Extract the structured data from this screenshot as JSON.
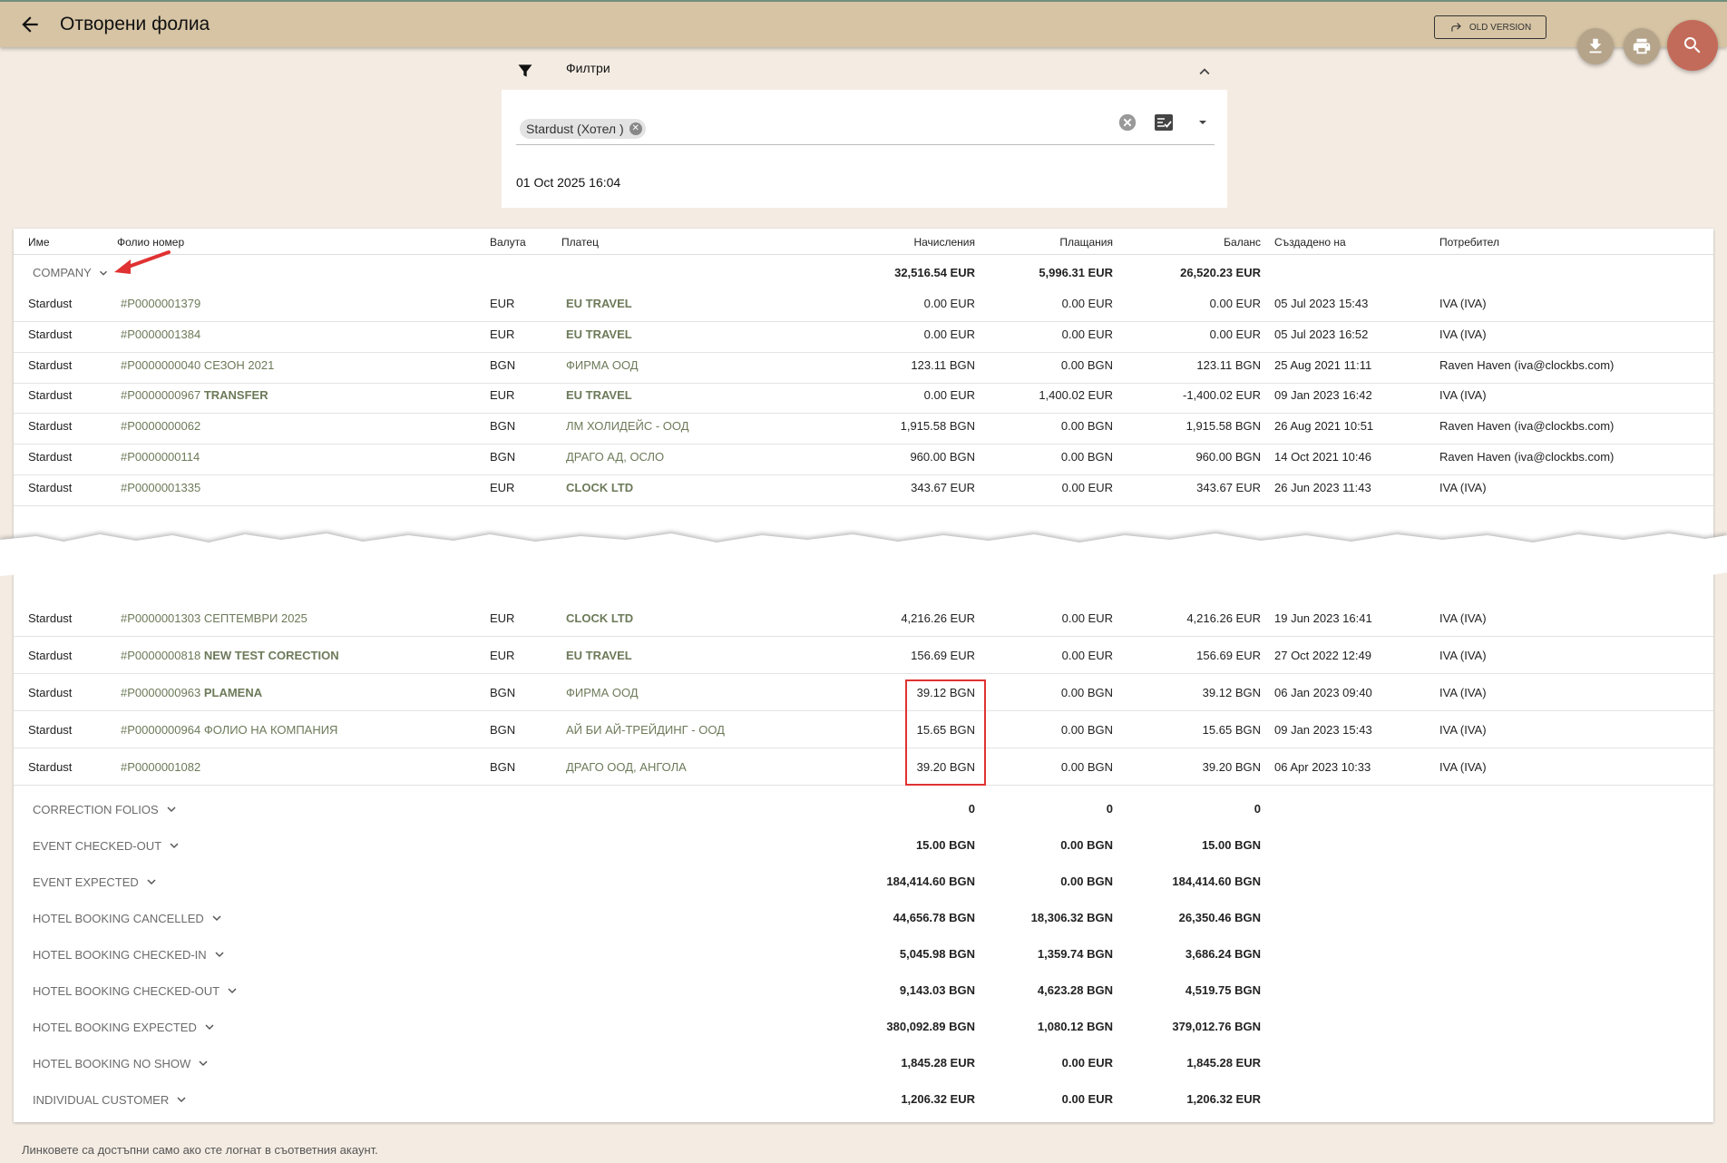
{
  "header": {
    "title": "Отворени фолиа",
    "old_version": "OLD VERSION"
  },
  "filter": {
    "label": "Филтри",
    "chip": "Stardust (Хотел )",
    "date": "01 Oct 2025 16:04"
  },
  "table": {
    "columns": [
      "Име",
      "Фолио номер",
      "Валута",
      "Платец",
      "Начисления",
      "Плащания",
      "Баланс",
      "Създадено на",
      "Потребител"
    ],
    "company_group": {
      "label": "COMPANY",
      "charges": "32,516.54 EUR",
      "payments": "5,996.31 EUR",
      "balance": "26,520.23 EUR"
    },
    "rows_top": [
      {
        "name": "Stardust",
        "folio": "#P0000001379",
        "folio_extra": "",
        "currency": "EUR",
        "payer": "EU TRAVEL",
        "charges": "0.00 EUR",
        "payments": "0.00 EUR",
        "balance": "0.00 EUR",
        "created": "05 Jul 2023 15:43",
        "user": "IVA (IVA)"
      },
      {
        "name": "Stardust",
        "folio": "#P0000001384",
        "folio_extra": "",
        "currency": "EUR",
        "payer": "EU TRAVEL",
        "charges": "0.00 EUR",
        "payments": "0.00 EUR",
        "balance": "0.00 EUR",
        "created": "05 Jul 2023 16:52",
        "user": "IVA (IVA)"
      },
      {
        "name": "Stardust",
        "folio": "#P0000000040",
        "folio_extra": "СЕЗОН 2021",
        "currency": "BGN",
        "payer": "ФИРМА ООД",
        "charges": "123.11 BGN",
        "payments": "0.00 BGN",
        "balance": "123.11 BGN",
        "created": "25 Aug 2021 11:11",
        "user": "Raven Haven (iva@clockbs.com)"
      },
      {
        "name": "Stardust",
        "folio": "#P0000000967",
        "folio_extra": "TRANSFER",
        "currency": "EUR",
        "payer": "EU TRAVEL",
        "charges": "0.00 EUR",
        "payments": "1,400.02 EUR",
        "balance": "-1,400.02 EUR",
        "created": "09 Jan 2023 16:42",
        "user": "IVA (IVA)"
      },
      {
        "name": "Stardust",
        "folio": "#P0000000062",
        "folio_extra": "",
        "currency": "BGN",
        "payer": "ЛМ ХОЛИДЕЙС - ООД",
        "charges": "1,915.58 BGN",
        "payments": "0.00 BGN",
        "balance": "1,915.58 BGN",
        "created": "26 Aug 2021 10:51",
        "user": "Raven Haven (iva@clockbs.com)"
      },
      {
        "name": "Stardust",
        "folio": "#P0000000114",
        "folio_extra": "",
        "currency": "BGN",
        "payer": "ДРАГО АД, ОСЛО",
        "charges": "960.00 BGN",
        "payments": "0.00 BGN",
        "balance": "960.00 BGN",
        "created": "14 Oct 2021 10:46",
        "user": "Raven Haven (iva@clockbs.com)"
      },
      {
        "name": "Stardust",
        "folio": "#P0000001335",
        "folio_extra": "",
        "currency": "EUR",
        "payer": "CLOCK LTD",
        "charges": "343.67 EUR",
        "payments": "0.00 EUR",
        "balance": "343.67 EUR",
        "created": "26 Jun 2023 11:43",
        "user": "IVA (IVA)"
      }
    ],
    "rows_bottom": [
      {
        "name": "Stardust",
        "folio": "#P0000001303",
        "folio_extra": "СЕПТЕМВРИ 2025",
        "currency": "EUR",
        "payer": "CLOCK LTD",
        "charges": "4,216.26 EUR",
        "payments": "0.00 EUR",
        "balance": "4,216.26 EUR",
        "created": "19 Jun 2023 16:41",
        "user": "IVA (IVA)"
      },
      {
        "name": "Stardust",
        "folio": "#P0000000818",
        "folio_extra": "NEW TEST CORECTION",
        "currency": "EUR",
        "payer": "EU TRAVEL",
        "charges": "156.69 EUR",
        "payments": "0.00 EUR",
        "balance": "156.69 EUR",
        "created": "27 Oct 2022 12:49",
        "user": "IVA (IVA)"
      },
      {
        "name": "Stardust",
        "folio": "#P0000000963",
        "folio_extra": "PLAMENA",
        "currency": "BGN",
        "payer": "ФИРМА ООД",
        "charges": "39.12 BGN",
        "payments": "0.00 BGN",
        "balance": "39.12 BGN",
        "created": "06 Jan 2023 09:40",
        "user": "IVA (IVA)"
      },
      {
        "name": "Stardust",
        "folio": "#P0000000964",
        "folio_extra": "ФОЛИО НА КОМПАНИЯ",
        "currency": "BGN",
        "payer": "АЙ БИ АЙ-ТРЕЙДИНГ - ООД",
        "charges": "15.65 BGN",
        "payments": "0.00 BGN",
        "balance": "15.65 BGN",
        "created": "09 Jan 2023 15:43",
        "user": "IVA (IVA)"
      },
      {
        "name": "Stardust",
        "folio": "#P0000001082",
        "folio_extra": "",
        "currency": "BGN",
        "payer": "ДРАГО ООД, АНГОЛА",
        "charges": "39.20 BGN",
        "payments": "0.00 BGN",
        "balance": "39.20 BGN",
        "created": "06 Apr 2023 10:33",
        "user": "IVA (IVA)"
      }
    ],
    "groups": [
      {
        "label": "CORRECTION FOLIOS",
        "charges": "0",
        "payments": "0",
        "balance": "0"
      },
      {
        "label": "EVENT CHECKED-OUT",
        "charges": "15.00 BGN",
        "payments": "0.00 BGN",
        "balance": "15.00 BGN"
      },
      {
        "label": "EVENT EXPECTED",
        "charges": "184,414.60 BGN",
        "payments": "0.00 BGN",
        "balance": "184,414.60 BGN"
      },
      {
        "label": "HOTEL BOOKING CANCELLED",
        "charges": "44,656.78 BGN",
        "payments": "18,306.32 BGN",
        "balance": "26,350.46 BGN"
      },
      {
        "label": "HOTEL BOOKING CHECKED-IN",
        "charges": "5,045.98 BGN",
        "payments": "1,359.74 BGN",
        "balance": "3,686.24 BGN"
      },
      {
        "label": "HOTEL BOOKING CHECKED-OUT",
        "charges": "9,143.03 BGN",
        "payments": "4,623.28 BGN",
        "balance": "4,519.75 BGN"
      },
      {
        "label": "HOTEL BOOKING EXPECTED",
        "charges": "380,092.89 BGN",
        "payments": "1,080.12 BGN",
        "balance": "379,012.76 BGN"
      },
      {
        "label": "HOTEL BOOKING NO SHOW",
        "charges": "1,845.28 EUR",
        "payments": "0.00 EUR",
        "balance": "1,845.28 EUR"
      },
      {
        "label": "INDIVIDUAL CUSTOMER",
        "charges": "1,206.32 EUR",
        "payments": "0.00 EUR",
        "balance": "1,206.32 EUR"
      }
    ]
  },
  "footer": {
    "note": "Линковете са достъпни само ако сте логнат в съответния акаунт."
  },
  "colors": {
    "topbar": "#d6c4a4",
    "background": "#f4ece3",
    "link": "#6c7a59",
    "fab_search": "#c36b5a",
    "highlight": "#e03232"
  },
  "icons": [
    "back-arrow-icon",
    "redo-icon",
    "download-icon",
    "print-icon",
    "search-icon",
    "filter-icon",
    "chevron-up-icon",
    "clear-icon",
    "select-all-icon",
    "dropdown-icon",
    "chevron-down-icon"
  ]
}
